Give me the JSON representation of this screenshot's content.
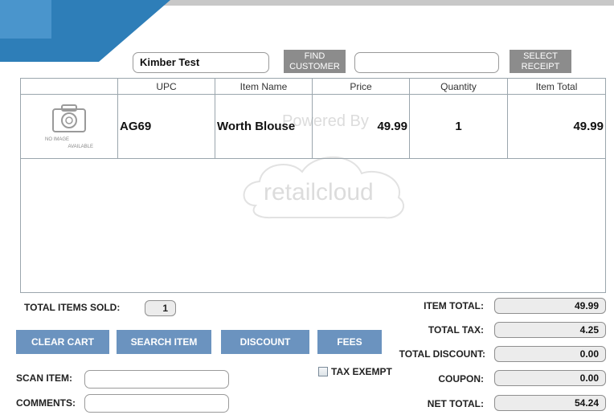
{
  "customer": {
    "name": "Kimber Test",
    "find_button": "FIND CUSTOMER",
    "receipt_value": "",
    "select_receipt_button": "SELECT RECEIPT"
  },
  "cart": {
    "columns": [
      "",
      "UPC",
      "Item Name",
      "Price",
      "Quantity",
      "Item Total"
    ],
    "rows": [
      {
        "image_placeholder": [
          "NO IMAGE",
          "AVAILABLE"
        ],
        "upc": "AG69",
        "item_name": "Worth Blouse",
        "price": "49.99",
        "quantity": "1",
        "item_total": "49.99"
      }
    ],
    "watermark": {
      "powered_by": "Powered By",
      "brand": "retailcloud"
    }
  },
  "summary": {
    "total_items_label": "TOTAL ITEMS SOLD:",
    "total_items_value": "1"
  },
  "actions": {
    "clear_cart": "CLEAR CART",
    "search_item": "SEARCH ITEM",
    "discount": "DISCOUNT",
    "fees": "FEES"
  },
  "tax_exempt": {
    "label": "TAX EXEMPT",
    "checked": false
  },
  "inputs": {
    "scan_item_label": "SCAN ITEM:",
    "scan_item_value": "",
    "comments_label": "COMMENTS:",
    "comments_value": ""
  },
  "totals": {
    "item_total_label": "ITEM TOTAL:",
    "item_total": "49.99",
    "total_tax_label": "TOTAL TAX:",
    "total_tax": "4.25",
    "total_discount_label": "TOTAL DISCOUNT:",
    "total_discount": "0.00",
    "coupon_label": "COUPON:",
    "coupon": "0.00",
    "net_total_label": "NET TOTAL:",
    "net_total": "54.24"
  },
  "colors": {
    "header_blue": "#2e7eb8",
    "header_grey": "#c8c8c8",
    "action_button": "#6b93bf",
    "gray_button": "#8c8c8c"
  }
}
